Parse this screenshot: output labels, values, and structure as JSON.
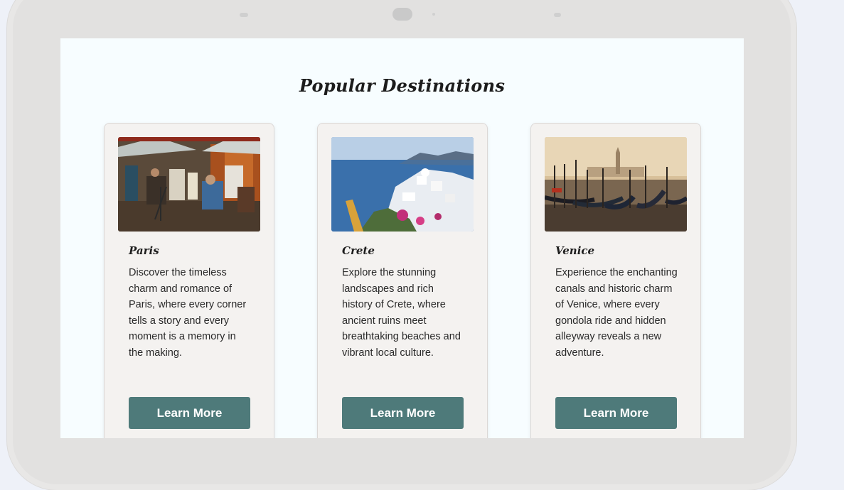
{
  "section": {
    "title": "Popular Destinations"
  },
  "destinations": [
    {
      "name": "Paris",
      "description": "Discover the timeless charm and romance of Paris, where every corner tells a story and every moment is a memory in the making.",
      "button_label": "Learn More",
      "image_icon": "paris-artists-square-image"
    },
    {
      "name": "Crete",
      "description": "Explore the stunning landscapes and rich history of Crete, where ancient ruins meet breathtaking beaches and vibrant local culture.",
      "button_label": "Learn More",
      "image_icon": "crete-seaside-village-image"
    },
    {
      "name": "Venice",
      "description": "Experience the enchanting canals and historic charm of Venice, where every gondola ride and hidden alleyway reveals a new adventure.",
      "button_label": "Learn More",
      "image_icon": "venice-gondolas-image"
    }
  ],
  "colors": {
    "button": "#4e7a7a",
    "card": "#f4f2f0",
    "screen": "#f7fdff",
    "device_frame": "#e2e1e0"
  }
}
